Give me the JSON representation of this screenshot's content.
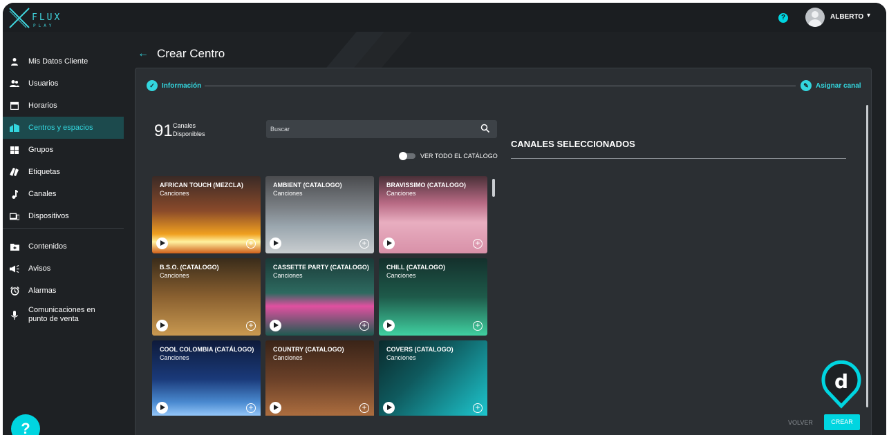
{
  "app": {
    "logo_text": "FLUX",
    "logo_sub": "PLAY"
  },
  "topbar": {
    "help": "?",
    "username": "ALBERTO",
    "chevron": "▾"
  },
  "sidebar": {
    "items": [
      {
        "label": "Mis Datos Cliente",
        "icon": "person-icon"
      },
      {
        "label": "Usuarios",
        "icon": "users-icon"
      },
      {
        "label": "Horarios",
        "icon": "calendar-icon"
      },
      {
        "label": "Centros y espacios",
        "icon": "building-icon",
        "active": true
      },
      {
        "label": "Grupos",
        "icon": "grid-icon"
      },
      {
        "label": "Etiquetas",
        "icon": "tags-icon"
      },
      {
        "label": "Canales",
        "icon": "music-note-icon"
      },
      {
        "label": "Dispositivos",
        "icon": "devices-icon"
      },
      {
        "label": "Contenidos",
        "icon": "folder-add-icon"
      },
      {
        "label": "Avisos",
        "icon": "megaphone-icon"
      },
      {
        "label": "Alarmas",
        "icon": "alarm-icon"
      },
      {
        "label": "Comunicaciones en punto de venta",
        "icon": "mic-icon"
      }
    ],
    "help_label": "?"
  },
  "main": {
    "back": "←",
    "title": "Crear Centro",
    "steps": [
      {
        "label": "Información",
        "icon": "check-icon"
      },
      {
        "label": "Asignar canal",
        "icon": "edit-icon"
      }
    ],
    "available_count": "91",
    "available_label": "Canales Disponibles",
    "search": {
      "placeholder": "Buscar"
    },
    "toggle_label": "VER TODO EL CATÁLOGO",
    "selected_title": "CANALES SELECCIONADOS",
    "volver": "VOLVER",
    "crear": "CREAR",
    "channels": [
      {
        "title": "AFRICAN TOUCH (MEZCLA)",
        "sub": "Canciones",
        "bg": "linear-gradient(180deg,#3a2a26 0%,#8a4a2a 45%,#f0a020 75%,#fff2a0 85%,#d0601a 100%)"
      },
      {
        "title": "AMBIENT (CATALOGO)",
        "sub": "Canciones",
        "bg": "linear-gradient(180deg,#4a4b4e 0%,#7a7f84 40%,#9aa6ae 65%,#c9cdd0 100%)"
      },
      {
        "title": "BRAVISSIMO (CATALOGO)",
        "sub": "Canciones",
        "bg": "linear-gradient(180deg,#4a3038 0%,#b86a84 35%,#e8aec0 60%,#d890a8 100%)"
      },
      {
        "title": "B.S.O. (CATALOGO)",
        "sub": "Canciones",
        "bg": "linear-gradient(180deg,#3a2c1a 0%,#8a6030 50%,#c89850 100%)"
      },
      {
        "title": "CASSETTE PARTY (CATALOGO)",
        "sub": "Canciones",
        "bg": "linear-gradient(180deg,#1a3a38 0%,#2e6a60 45%,#e050a0 62%,#1e5a50 100%)"
      },
      {
        "title": "CHILL (CATALOGO)",
        "sub": "Canciones",
        "bg": "linear-gradient(180deg,#14302c 0%,#1e5a4a 50%,#40d0a0 100%)"
      },
      {
        "title": "COOL COLOMBIA (CATÁLOGO)",
        "sub": "Canciones",
        "bg": "linear-gradient(180deg,#0e1a3a 0%,#1a3a7a 50%,#4a8ad0 80%,#a0d0ff 100%)"
      },
      {
        "title": "COUNTRY (CATALOGO)",
        "sub": "Canciones",
        "bg": "linear-gradient(180deg,#3a2418 0%,#6a4028 50%,#b07040 100%)"
      },
      {
        "title": "COVERS (CATALOGO)",
        "sub": "Canciones",
        "bg": "linear-gradient(135deg,#0a2a2c 0%,#0f5a5e 40%,#1ec8d0 100%)"
      }
    ]
  },
  "colors": {
    "accent": "#00d5e0",
    "bg": "#1e2124",
    "panel": "#2b2f33"
  }
}
